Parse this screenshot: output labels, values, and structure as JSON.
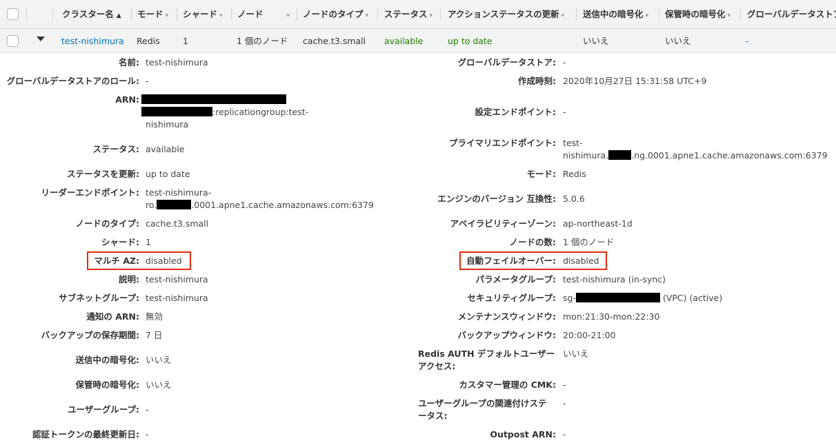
{
  "header": {
    "columns": [
      {
        "label": "クラスター名",
        "sort": "▲"
      },
      {
        "label": "モード"
      },
      {
        "label": "シャード"
      },
      {
        "label": "ノード"
      },
      {
        "label": "ノードのタイプ"
      },
      {
        "label": "ステータス"
      },
      {
        "label": "アクションステータスの更新"
      },
      {
        "label": "送信中の暗号化"
      },
      {
        "label": "保管時の暗号化"
      },
      {
        "label": "グローバルデータストア"
      }
    ],
    "caret": "▾"
  },
  "row": {
    "name": "test-nishimura",
    "mode": "Redis",
    "shards": "1",
    "nodes": "1 個のノード",
    "node_type": "cache.t3.small",
    "status": "available",
    "update_status": "up to date",
    "transit_encryption": "いいえ",
    "rest_encryption": "いいえ",
    "global_datastore": "-"
  },
  "left": {
    "name": {
      "label": "名前:",
      "value": "test-nishimura"
    },
    "global_role": {
      "label": "グローバルデータストアのロール:",
      "value": "-"
    },
    "arn": {
      "label": "ARN:",
      "value_suffix": ":replicationgroup:test-",
      "value_line3": "nishimura"
    },
    "status": {
      "label": "ステータス:",
      "value": "available"
    },
    "update_status": {
      "label": "ステータスを更新:",
      "value": "up to date"
    },
    "reader_endpoint": {
      "label": "リーダーエンドポイント:",
      "line1": "test-nishimura-",
      "line2_prefix": "ro.",
      "line2_suffix": ".0001.apne1.cache.amazonaws.com:6379"
    },
    "node_type": {
      "label": "ノードのタイプ:",
      "value": "cache.t3.small"
    },
    "shards": {
      "label": "シャード:",
      "value": "1"
    },
    "multi_az": {
      "label": "マルチ AZ:",
      "value": "disabled"
    },
    "description": {
      "label": "説明:",
      "value": "test-nishimura"
    },
    "subnet_group": {
      "label": "サブネットグループ:",
      "value": "test-nishimura"
    },
    "notification_arn": {
      "label": "通知の ARN:",
      "value": "無効"
    },
    "backup_retention": {
      "label": "バックアップの保存期間:",
      "value": "7 日"
    },
    "transit_encryption": {
      "label": "送信中の暗号化:",
      "value": "いいえ"
    },
    "rest_encryption": {
      "label": "保管時の暗号化:",
      "value": "いいえ"
    },
    "user_group": {
      "label": "ユーザーグループ:",
      "value": "-"
    },
    "auth_token_updated": {
      "label": "認証トークンの最終更新日:",
      "value": "-"
    }
  },
  "right": {
    "global_datastore": {
      "label": "グローバルデータストア:",
      "value": "-"
    },
    "created": {
      "label": "作成時刻:",
      "value": "2020年10月27日 15:31:58 UTC+9"
    },
    "config_endpoint": {
      "label": "設定エンドポイント:",
      "value": "-"
    },
    "primary_endpoint": {
      "label": "プライマリエンドポイント:",
      "line1": "test-",
      "line2_prefix": "nishimura.",
      "line2_suffix": ".ng.0001.apne1.cache.amazonaws.com:6379"
    },
    "mode": {
      "label": "モード:",
      "value": "Redis"
    },
    "engine_version": {
      "label": "エンジンのバージョン 互換性:",
      "value": "5.0.6"
    },
    "az": {
      "label": "アベイラビリティーゾーン:",
      "value": "ap-northeast-1d"
    },
    "node_count": {
      "label": "ノードの数:",
      "value": "1 個のノード"
    },
    "auto_failover": {
      "label": "自動フェイルオーバー:",
      "value": "disabled"
    },
    "param_group": {
      "label": "パラメータグループ:",
      "value": "test-nishimura (in-sync)"
    },
    "security_group": {
      "label": "セキュリティグループ:",
      "value_prefix": "sg-",
      "value_suffix": " (VPC) (active)"
    },
    "maintenance_window": {
      "label": "メンテナンスウィンドウ:",
      "value": "mon:21:30-mon:22:30"
    },
    "backup_window": {
      "label": "バックアップウィンドウ:",
      "value": "20:00-21:00"
    },
    "redis_auth": {
      "label_line1": "Redis AUTH デフォルトユーザー",
      "label_line2": "アクセス:",
      "value": "いいえ"
    },
    "cmk": {
      "label": "カスタマー管理の CMK:",
      "value": "-"
    },
    "user_group_status": {
      "label_line1": "ユーザーグループの関連付けステ",
      "label_line2": "ータス:",
      "value": "-"
    },
    "outpost_arn": {
      "label": "Outpost ARN:",
      "value": "-"
    }
  },
  "colors": {
    "link": "#0073bb",
    "status_ok": "#1d8102",
    "highlight": "#e8290a"
  }
}
